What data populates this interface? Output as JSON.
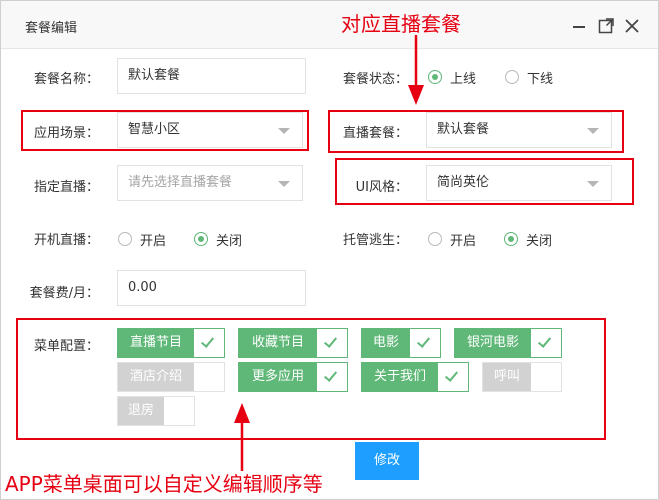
{
  "window": {
    "title": "套餐编辑"
  },
  "form": {
    "name": {
      "label": "套餐名称：",
      "value": "默认套餐"
    },
    "status": {
      "label": "套餐状态：",
      "options": [
        "上线",
        "下线"
      ],
      "selected": "上线"
    },
    "scene": {
      "label": "应用场景：",
      "value": "智慧小区"
    },
    "live_pkg": {
      "label": "直播套餐：",
      "value": "默认套餐"
    },
    "assign_live": {
      "label": "指定直播：",
      "placeholder": "请先选择直播套餐"
    },
    "ui_style": {
      "label": "UI风格：",
      "value": "简尚英伦"
    },
    "boot_live": {
      "label": "开机直播：",
      "options": [
        "开启",
        "关闭"
      ],
      "selected": "关闭"
    },
    "escape": {
      "label": "托管逃生：",
      "options": [
        "开启",
        "关闭"
      ],
      "selected": "关闭"
    },
    "fee": {
      "label": "套餐费/月：",
      "value": "0.00"
    },
    "menu": {
      "label": "菜单配置：",
      "items": [
        {
          "label": "直播节目",
          "on": true
        },
        {
          "label": "收藏节目",
          "on": true
        },
        {
          "label": "电影",
          "on": true
        },
        {
          "label": "银河电影",
          "on": true
        },
        {
          "label": "酒店介绍",
          "on": false
        },
        {
          "label": "更多应用",
          "on": true
        },
        {
          "label": "关于我们",
          "on": true
        },
        {
          "label": "呼叫",
          "on": false
        },
        {
          "label": "退房",
          "on": false
        }
      ]
    },
    "submit_label": "修改"
  },
  "annotations": {
    "top": "对应直播套餐",
    "bottom": "APP菜单桌面可以自定义编辑顺序等",
    "color": "#e60012"
  },
  "colors": {
    "accent": "#5fb878",
    "primary": "#1e9fff",
    "disabled": "#d2d2d2"
  }
}
